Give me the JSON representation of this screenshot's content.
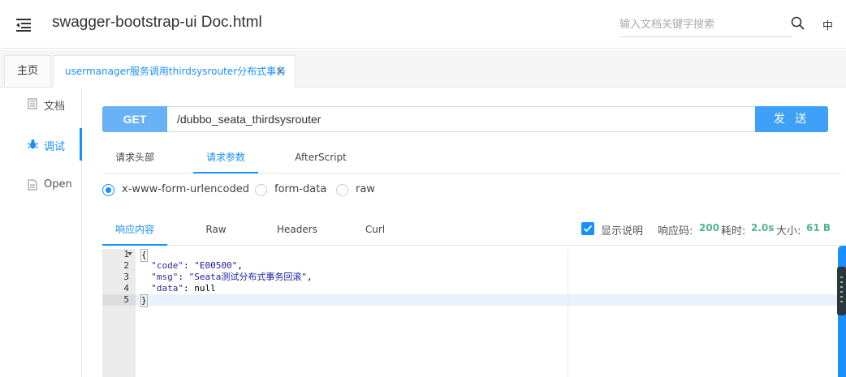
{
  "header": {
    "title": "swagger-bootstrap-ui Doc.html",
    "search_placeholder": "输入文档关键字搜索",
    "lang": "中"
  },
  "tabs": {
    "home": "主页",
    "active": "usermanager服务调用thirdsysrouter分布式事务",
    "close": "×"
  },
  "sidebar": {
    "items": [
      {
        "label": "文档",
        "icon": "document-icon"
      },
      {
        "label": "调试",
        "icon": "bug-icon"
      },
      {
        "label": "Open",
        "icon": "file-icon"
      }
    ]
  },
  "request": {
    "method": "GET",
    "url": "/dubbo_seata_thirdsysrouter",
    "send_label": "发 送",
    "tabs": [
      "请求头部",
      "请求参数",
      "AfterScript"
    ],
    "content_types": [
      "x-www-form-urlencoded",
      "form-data",
      "raw"
    ]
  },
  "response": {
    "tabs": [
      "响应内容",
      "Raw",
      "Headers",
      "Curl"
    ],
    "show_desc_label": "显示说明",
    "status_label": "响应码:",
    "status_value": "200",
    "time_label": "耗时:",
    "time_value": "2.0s",
    "size_label": "大小:",
    "size_value": "61 B",
    "line_numbers": [
      "1",
      "2",
      "3",
      "4",
      "5"
    ],
    "code": {
      "open": "{",
      "k1": "\"code\"",
      "v1": "\"E00500\"",
      "k2": "\"msg\"",
      "v2": "\"Seata测试分布式事务回滚\"",
      "k3": "\"data\"",
      "v3": "null",
      "close": "}"
    }
  },
  "colors": {
    "accent": "#1890ff",
    "method_bg": "#69b1f5",
    "send_bg": "#3fa0f7",
    "meta_value": "#52b58b"
  }
}
